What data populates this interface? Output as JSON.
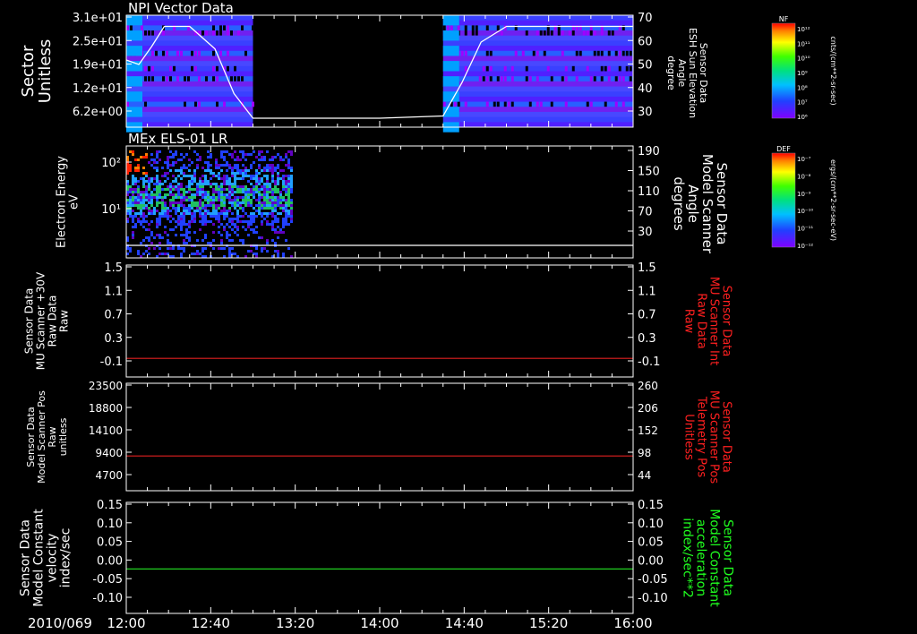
{
  "date_label": "2010/069",
  "x_ticks": [
    "12:00",
    "12:40",
    "13:20",
    "14:00",
    "14:40",
    "15:20",
    "16:00"
  ],
  "colorbars": [
    {
      "tag": "NF",
      "unit": "cnts/(cm**2-sr-sec)",
      "ticks": [
        "10¹²",
        "10¹¹",
        "10¹⁰",
        "10⁹",
        "10⁸",
        "10⁷",
        "10⁶"
      ]
    },
    {
      "tag": "DEF",
      "unit": "ergs/(cm**2-sr-sec-eV)",
      "ticks": [
        "10⁻⁷",
        "10⁻⁸",
        "10⁻⁹",
        "10⁻¹⁰",
        "10⁻¹¹",
        "10⁻¹²"
      ]
    }
  ],
  "chart_data": [
    {
      "type": "heatmap",
      "title": "NPI Vector Data",
      "ylabel": [
        "Sector",
        "Unitless"
      ],
      "y_ticks": [
        "3.1e+01",
        "2.5e+01",
        "1.9e+01",
        "1.2e+01",
        "6.2e+00"
      ],
      "ylim": [
        0,
        31
      ],
      "data_coverage_hours": [
        [
          12.0,
          13.0
        ],
        [
          14.5,
          16.0
        ]
      ],
      "right_axis": {
        "label": [
          "Sensor Data",
          "ESH Sun Elevation",
          "Angle",
          "degree"
        ],
        "ticks": [
          "70",
          "60",
          "50",
          "40",
          "30"
        ],
        "ylim": [
          20,
          70
        ]
      },
      "line_series": {
        "x": [
          12.0,
          12.1,
          12.2,
          12.3,
          12.5,
          12.7,
          12.85,
          13.0,
          13.2,
          14.0,
          14.5,
          14.65,
          14.8,
          15.0,
          15.5,
          16.0
        ],
        "y": [
          50,
          48,
          56,
          65,
          65,
          55,
          35,
          24,
          24,
          24,
          25,
          40,
          58,
          65,
          65,
          65
        ],
        "color": "#ffffff"
      }
    },
    {
      "type": "heatmap",
      "title": "MEx ELS-01 LR",
      "ylabel": [
        "Electron Energy",
        "eV"
      ],
      "y_ticks": [
        "10²",
        "10¹"
      ],
      "log_y": true,
      "data_coverage_hours": [
        [
          12.0,
          13.3
        ]
      ],
      "right_axis": {
        "label": [
          "Sensor Data",
          "Model Scanner",
          "Angle",
          "degrees"
        ],
        "ticks": [
          "190",
          "150",
          "110",
          "70",
          "30"
        ],
        "ylim": [
          0,
          190
        ]
      },
      "line_series": {
        "x": [
          12.0,
          16.0
        ],
        "y": [
          10,
          10
        ],
        "color": "#ffffff"
      }
    },
    {
      "type": "line",
      "ylabel": [
        "Sensor Data",
        "MU Scanner +30V",
        "Raw Data",
        "Raw"
      ],
      "y_ticks": [
        "1.5",
        "1.1",
        "0.7",
        "0.3",
        "-0.1"
      ],
      "ylim": [
        -0.3,
        1.5
      ],
      "right_axis": {
        "label": [
          "Sensor Data",
          "MU Scanner Int",
          "Raw Data",
          "Raw"
        ],
        "ticks": [
          "1.5",
          "1.1",
          "0.7",
          "0.3",
          "-0.1"
        ],
        "ylim": [
          -0.3,
          1.5
        ],
        "label_color": "#ff2020"
      },
      "series": [
        {
          "x": [
            12.0,
            16.0
          ],
          "y": [
            0.0,
            0.0
          ],
          "color": "#e02020"
        }
      ]
    },
    {
      "type": "line",
      "ylabel": [
        "Sensor Data",
        "Model Scanner Pos",
        "Raw",
        "unitless"
      ],
      "y_ticks": [
        "23500",
        "18800",
        "14100",
        "9400",
        "4700"
      ],
      "ylim": [
        0,
        23500
      ],
      "right_axis": {
        "label": [
          "Sensor Data",
          "MU Scanner Pos",
          "Telemetry Pos",
          "Unitless"
        ],
        "ticks": [
          "260",
          "206",
          "152",
          "98",
          "44"
        ],
        "ylim": [
          0,
          260
        ],
        "label_color": "#ff2020"
      },
      "series": [
        {
          "x": [
            12.0,
            16.0
          ],
          "y": [
            7600,
            7600
          ],
          "color": "#e02020"
        }
      ]
    },
    {
      "type": "line",
      "ylabel": [
        "Sensor Data",
        "Model Constant",
        "velocity",
        "index/sec"
      ],
      "y_ticks": [
        "0.15",
        "0.10",
        "0.05",
        "0.00",
        "-0.05",
        "-0.10"
      ],
      "ylim": [
        -0.1,
        0.15
      ],
      "right_axis": {
        "label": [
          "Sensor Data",
          "Model Constant",
          "acceleration",
          "index/sec**2"
        ],
        "ticks": [
          "0.15",
          "0.10",
          "0.05",
          "0.00",
          "-0.05",
          "-0.10"
        ],
        "ylim": [
          -0.1,
          0.15
        ],
        "label_color": "#20ff20"
      },
      "series": [
        {
          "x": [
            12.0,
            16.0
          ],
          "y": [
            0.0,
            0.0
          ],
          "color": "#20d020"
        }
      ]
    }
  ]
}
